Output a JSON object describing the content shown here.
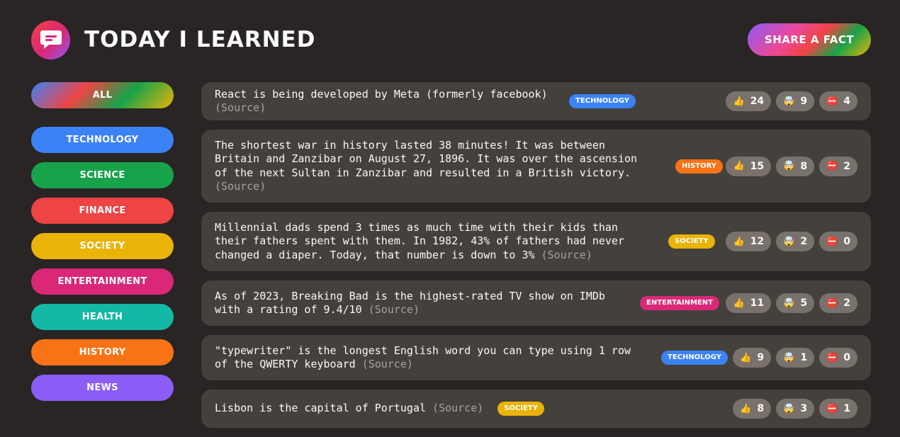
{
  "app": {
    "title": "TODAY I LEARNED",
    "share_label": "SHARE A FACT"
  },
  "sidebar": {
    "all_label": "ALL",
    "categories": [
      {
        "label": "technology",
        "color": "#3b82f6"
      },
      {
        "label": "science",
        "color": "#16a34a"
      },
      {
        "label": "finance",
        "color": "#ef4444"
      },
      {
        "label": "society",
        "color": "#eab308"
      },
      {
        "label": "entertainment",
        "color": "#db2777"
      },
      {
        "label": "health",
        "color": "#14b8a6"
      },
      {
        "label": "history",
        "color": "#f97316"
      },
      {
        "label": "news",
        "color": "#8b5cf6"
      }
    ]
  },
  "source_label": "(Source)",
  "facts": [
    {
      "text": "React is being developed by Meta (formerly facebook)",
      "category": "technology",
      "color": "#3b82f6",
      "votes": {
        "interesting": "24",
        "mindblowing": "9",
        "false": "4"
      }
    },
    {
      "text": "The shortest war in history lasted 38 minutes! It was between Britain and Zanzibar on August 27, 1896. It was over the ascension of the next Sultan in Zanzibar and resulted in a British victory.",
      "category": "history",
      "color": "#f97316",
      "votes": {
        "interesting": "15",
        "mindblowing": "8",
        "false": "2"
      }
    },
    {
      "text": "Millennial dads spend 3 times as much time with their kids than their fathers spent with them. In 1982, 43% of fathers had never changed a diaper. Today, that number is down to 3%",
      "category": "society",
      "color": "#eab308",
      "votes": {
        "interesting": "12",
        "mindblowing": "2",
        "false": "0"
      }
    },
    {
      "text": "As of 2023, Breaking Bad is the highest-rated TV show on IMDb with a rating of 9.4/10",
      "category": "entertainment",
      "color": "#db2777",
      "votes": {
        "interesting": "11",
        "mindblowing": "5",
        "false": "2"
      }
    },
    {
      "text": "\"typewriter\" is the longest English word you can type using 1 row of the QWERTY keyboard",
      "category": "technology",
      "color": "#3b82f6",
      "votes": {
        "interesting": "9",
        "mindblowing": "1",
        "false": "0"
      }
    },
    {
      "text": "Lisbon is the capital of Portugal",
      "category": "society",
      "color": "#eab308",
      "votes": {
        "interesting": "8",
        "mindblowing": "3",
        "false": "1"
      }
    }
  ],
  "icons": {
    "logo": "chat-bubble-icon",
    "interesting": "👍",
    "mindblowing": "🤯",
    "false": "⛔️"
  }
}
